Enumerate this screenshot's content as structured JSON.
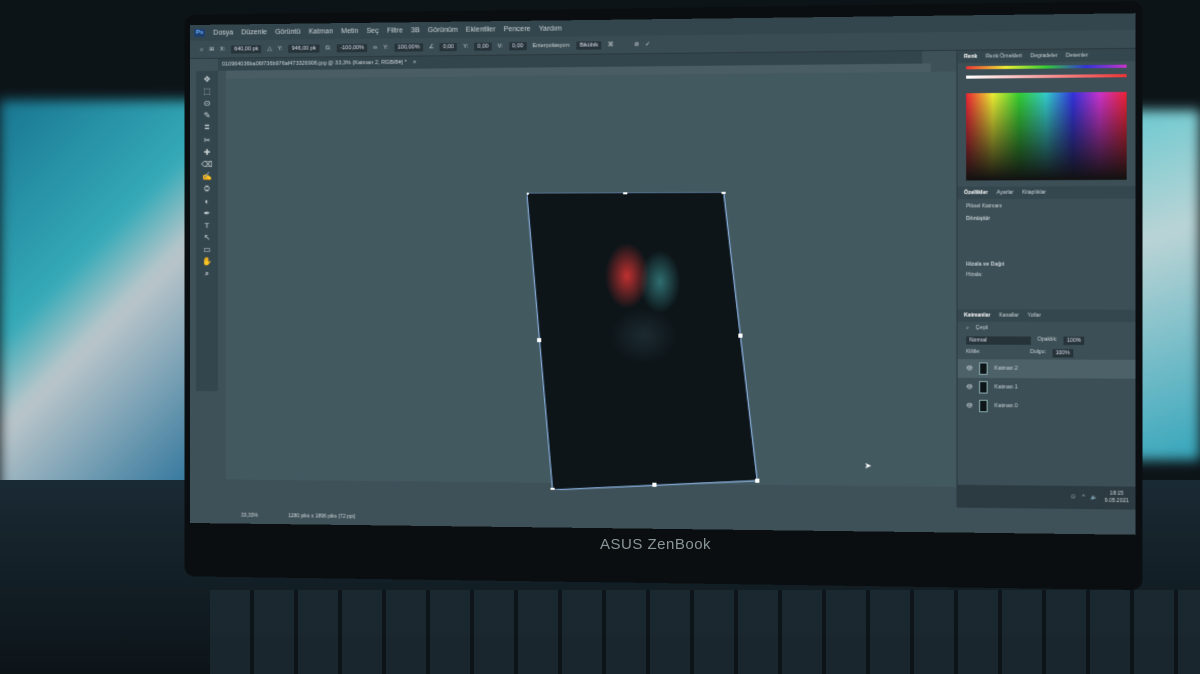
{
  "app": {
    "logo": "Ps",
    "menu": [
      "Dosya",
      "Düzenle",
      "Görüntü",
      "Katman",
      "Metin",
      "Seç",
      "Filtre",
      "3B",
      "Görünüm",
      "Eklentiler",
      "Pencere",
      "Yardım"
    ]
  },
  "options": {
    "x": "640,00 pk",
    "y": "946,00 pk",
    "w": "-100,00%",
    "h": "100,00%",
    "angle": "0,00",
    "h_skew": "0,00",
    "v_skew": "0,00",
    "interp_label": "Enterpolasyon:",
    "interp_value": "Bikübik"
  },
  "document": {
    "tab": "010964036ba06f736b976af473326906.jpg @ 33,3% (Katman 2, RGB/8#) *",
    "zoom": "33,33%",
    "size": "1280 piks x 1896 piks (72 ppi)"
  },
  "tools": [
    "✥",
    "⬚",
    "ʘ",
    "✎",
    "⌗",
    "✂",
    "✚",
    "⌫",
    "✍",
    "⛭",
    "◐",
    "✒",
    "T",
    "↖",
    "▭",
    "✋",
    "⌕"
  ],
  "color_panel": {
    "tabs": [
      "Renk",
      "Renk Örnekleri",
      "Degradeler",
      "Desenler"
    ]
  },
  "properties": {
    "tabs": [
      "Özellikler",
      "Ayarlar",
      "Kitaplıklar"
    ],
    "kind": "Piksel Katmanı",
    "transform": "Dönüştür",
    "align": "Hizala ve Dağıt",
    "align_sub": "Hizala:"
  },
  "layers_panel": {
    "tabs": [
      "Katmanlar",
      "Kanallar",
      "Yollar"
    ],
    "search": "Çeşit",
    "blend": "Normal",
    "opacity_label": "Opaklık:",
    "opacity": "100%",
    "lock_label": "Kilitle:",
    "fill_label": "Dolgu:",
    "fill": "100%",
    "layers": [
      "Katman 2",
      "Katman 1",
      "Katman 0"
    ],
    "selected": 0
  },
  "taskbar": {
    "time": "18:15",
    "date": "9.05.2021"
  },
  "device": {
    "brand": "ASUS ZenBook"
  }
}
